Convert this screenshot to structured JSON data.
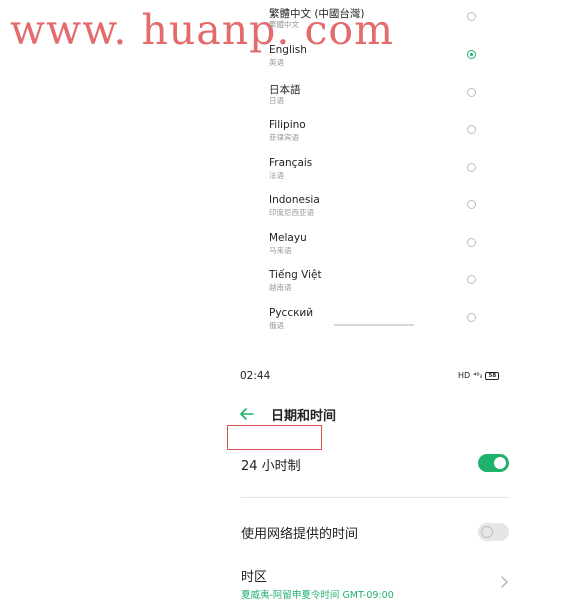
{
  "watermark": "www. huanp. com",
  "languages": [
    {
      "name": "繁體中文 (中國台灣)",
      "sub": "繁體中文",
      "selected": false
    },
    {
      "name": "English",
      "sub": "英语",
      "selected": true
    },
    {
      "name": "日本語",
      "sub": "日语",
      "selected": false
    },
    {
      "name": "Filipino",
      "sub": "菲律宾语",
      "selected": false
    },
    {
      "name": "Français",
      "sub": "法语",
      "selected": false
    },
    {
      "name": "Indonesia",
      "sub": "印度尼西亚语",
      "selected": false
    },
    {
      "name": "Melayu",
      "sub": "马来语",
      "selected": false
    },
    {
      "name": "Tiếng Việt",
      "sub": "越南语",
      "selected": false
    },
    {
      "name": "Русский",
      "sub": "俄语",
      "selected": false
    }
  ],
  "status_bar": {
    "time": "02:44",
    "hd": "HD",
    "signal": "⁴⁶ᵢₗ",
    "battery": "58"
  },
  "header": {
    "title": "日期和时间"
  },
  "settings": {
    "hour24": {
      "label": "24 小时制",
      "enabled": true
    },
    "network_time": {
      "label": "使用网络提供的时间",
      "enabled": false
    },
    "timezone": {
      "label": "时区",
      "value": "夏威夷-阿留申夏令时间 GMT-09:00"
    }
  },
  "colors": {
    "accent": "#1fb26b",
    "watermark": "#e36b6b",
    "highlight_box": "#d9534f"
  }
}
